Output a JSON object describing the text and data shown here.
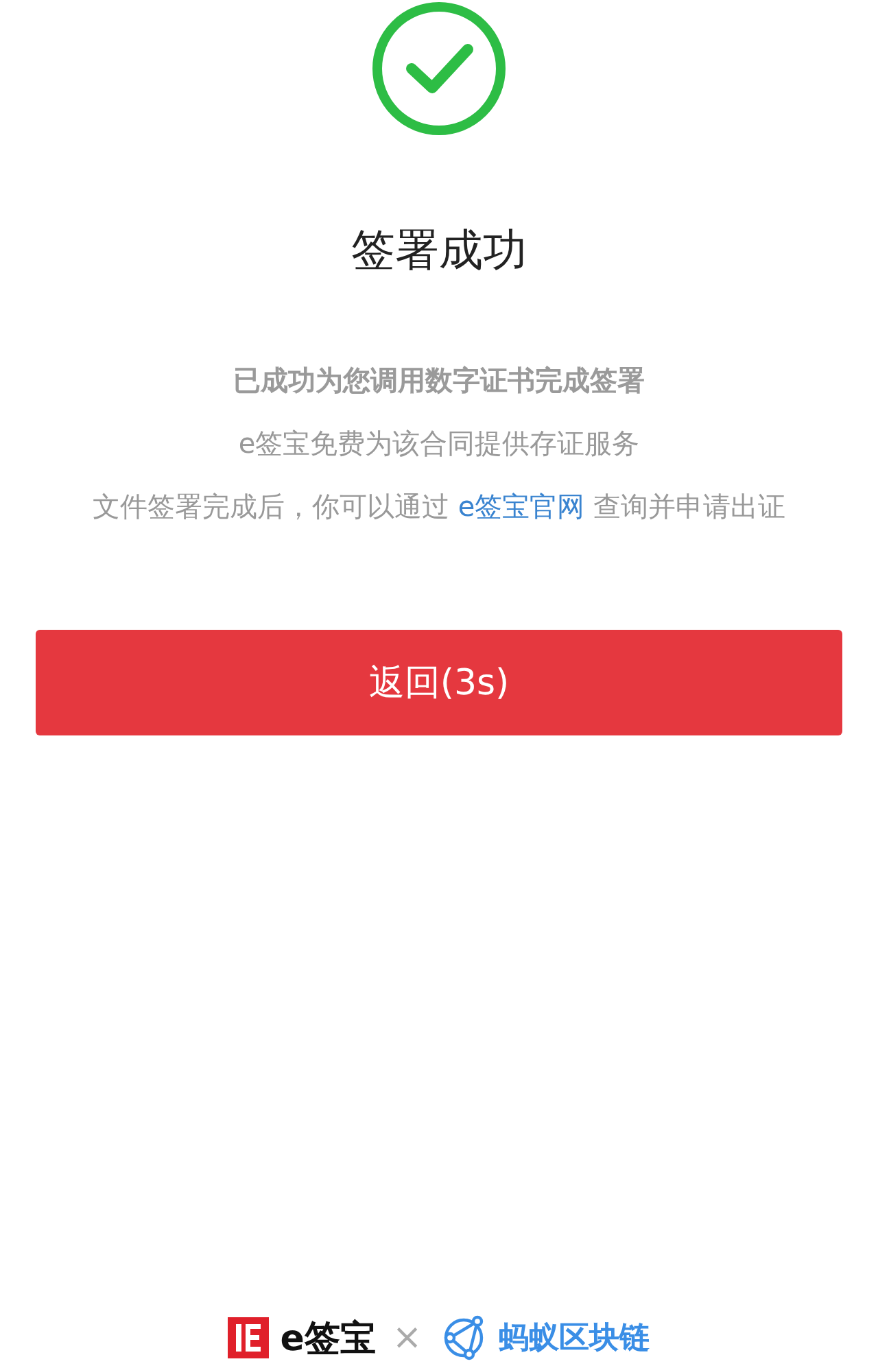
{
  "title": "签署成功",
  "messages": [
    {
      "text": "已成功为您调用数字证书完成签署",
      "kind": "bold"
    },
    {
      "text": "e签宝免费为该合同提供存证服务",
      "kind": "plain"
    },
    {
      "kind": "link",
      "before": "文件签署完成后，你可以通过 ",
      "link": "e签宝官网",
      "after": " 查询并申请出证"
    }
  ],
  "button": "返回(3s)",
  "footer": {
    "brand": "e签宝",
    "times": "×",
    "partner": "蚂蚁区块链"
  }
}
